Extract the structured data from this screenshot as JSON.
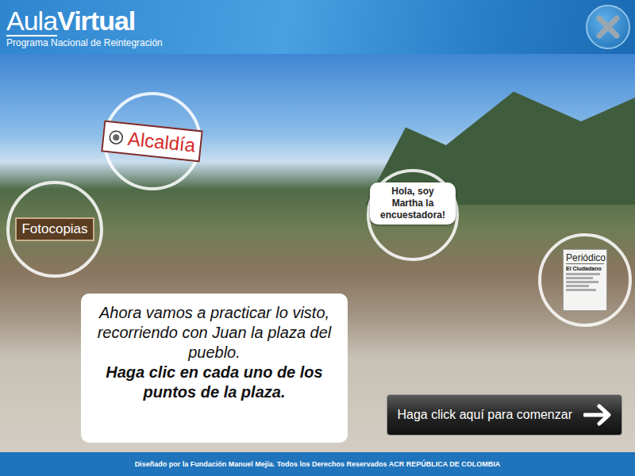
{
  "header": {
    "logo_first": "Aula",
    "logo_second": "Virtual",
    "subtitle": "Programa Nacional de Reintegración"
  },
  "hotspots": [
    {
      "kind": "town-hall",
      "label": "Alcaldía"
    },
    {
      "kind": "copies",
      "label": "Fotocopias"
    },
    {
      "kind": "bubble",
      "label": "Hola, soy Martha la encuestadora!"
    },
    {
      "kind": "newspaper",
      "label": "Periódico",
      "masthead": "El Ciudadano"
    }
  ],
  "instruction": {
    "text": "Ahora vamos a practicar lo visto, recorriendo con Juan la plaza del pueblo.",
    "emphasis": "Haga clic en cada uno de los puntos de la plaza."
  },
  "start_button": {
    "label": "Haga click aquí para comenzar"
  },
  "footer": {
    "text": "Diseñado por la Fundación Manuel Mejía. Todos los Derechos Reservados ACR REPÚBLICA DE COLOMBIA"
  }
}
